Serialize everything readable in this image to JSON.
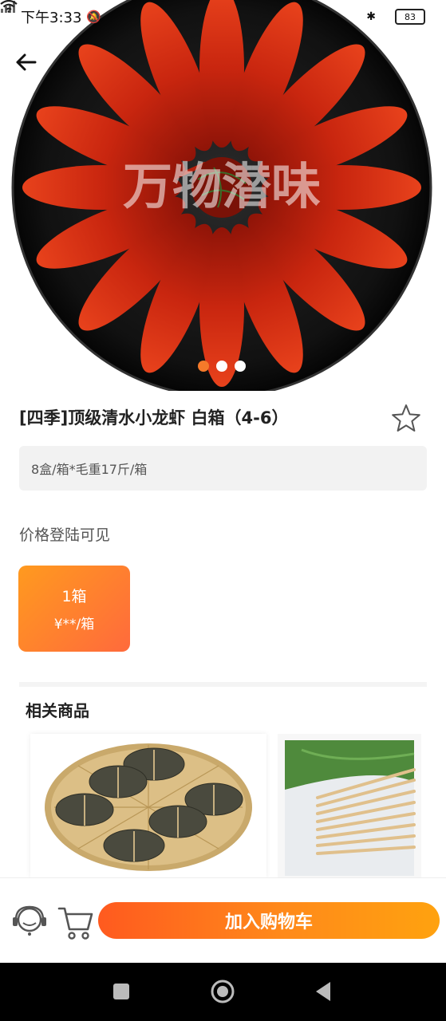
{
  "status_bar": {
    "time": "下午3:33",
    "battery": "83"
  },
  "hero": {
    "watermark_text": "万物潜味",
    "dots": [
      true,
      false,
      false
    ],
    "accent_color": "#f57a2a"
  },
  "product": {
    "title": "[四季]顶级清水小龙虾 白箱（4-6）",
    "spec": "8盒/箱*毛重17斤/箱",
    "price_note": "价格登陆可见",
    "qty_label": "1箱",
    "qty_price": "¥**/箱"
  },
  "related": {
    "title": "相关商品"
  },
  "actions": {
    "add_to_cart": "加入购物车",
    "service_icon": "customer-service-icon",
    "cart_icon": "cart-icon"
  },
  "colors": {
    "brand_orange": "#ff7a1a",
    "lobster_red": "#c9260f",
    "plate_black": "#111111"
  }
}
